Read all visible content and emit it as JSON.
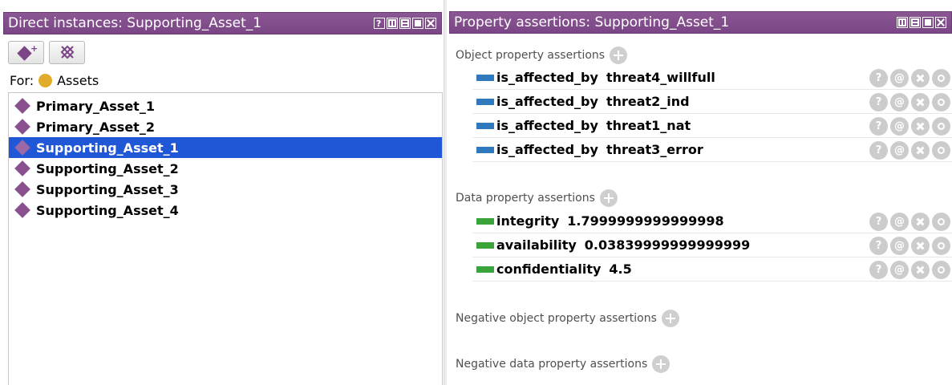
{
  "left_panel": {
    "title": "Direct instances: Supporting_Asset_1",
    "for_label": "For:",
    "for_class": "Assets",
    "individuals": [
      "Primary_Asset_1",
      "Primary_Asset_2",
      "Supporting_Asset_1",
      "Supporting_Asset_2",
      "Supporting_Asset_3",
      "Supporting_Asset_4"
    ],
    "selected": "Supporting_Asset_1"
  },
  "right_panel": {
    "title": "Property assertions: Supporting_Asset_1",
    "object_header": "Object property assertions",
    "object_assertions": [
      {
        "property": "is_affected_by",
        "value": "threat4_willfull"
      },
      {
        "property": "is_affected_by",
        "value": "threat2_ind"
      },
      {
        "property": "is_affected_by",
        "value": "threat1_nat"
      },
      {
        "property": "is_affected_by",
        "value": "threat3_error"
      }
    ],
    "data_header": "Data property assertions",
    "data_assertions": [
      {
        "property": "integrity",
        "value": "1.7999999999999998"
      },
      {
        "property": "availability",
        "value": "0.03839999999999999"
      },
      {
        "property": "confidentiality",
        "value": "4.5"
      }
    ],
    "neg_object_header": "Negative object property assertions",
    "neg_data_header": "Negative data property assertions",
    "row_actions": {
      "help": "?",
      "annotate": "@"
    }
  },
  "colors": {
    "titlebar": "#7b4685",
    "selection": "#1f57d6",
    "object_property": "#2e78be",
    "data_property": "#3aa33a",
    "class_dot": "#e2ac2a",
    "individual_icon": "#8a4f8f"
  },
  "icons": {
    "add_individual": "add-individual-icon",
    "delete_individual": "delete-individual-icon",
    "class": "class-circle-icon",
    "individual": "individual-diamond-icon",
    "add": "add-circle-icon"
  }
}
